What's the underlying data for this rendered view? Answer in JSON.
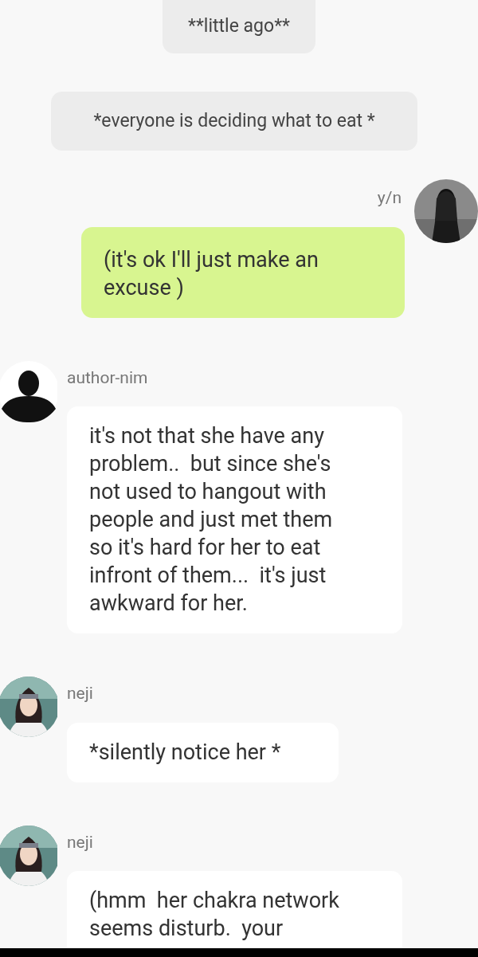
{
  "messages": [
    {
      "kind": "pill",
      "text": "**little ago**"
    },
    {
      "kind": "notice",
      "text": "*everyone is deciding what to eat *"
    },
    {
      "kind": "outgoing",
      "sender": "y/n",
      "text": "(it's ok I'll just make an excuse )"
    },
    {
      "kind": "incoming",
      "sender": "author-nim",
      "avatar": {
        "kind": "silhouette"
      },
      "text": "it's not that she have any problem..  but since she's not used to hangout with people and just met them so it's hard for her to eat infront of them...  it's just awkward for her."
    },
    {
      "kind": "incoming",
      "sender": "neji",
      "text": "*silently notice her *"
    },
    {
      "kind": "incoming",
      "sender": "neji",
      "text": "(hmm  her chakra network seems disturb.  your"
    }
  ]
}
